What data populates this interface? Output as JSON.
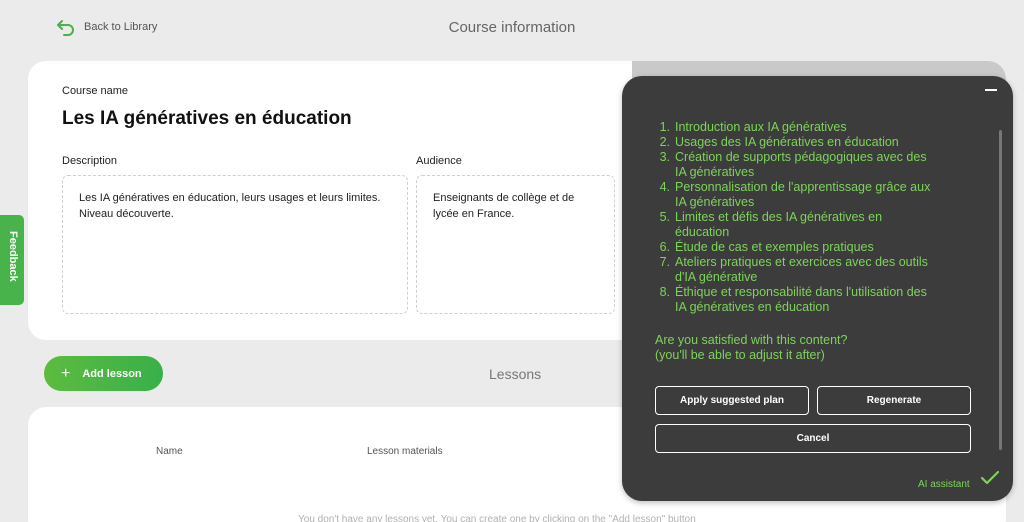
{
  "header": {
    "back_label": "Back to Library",
    "page_title": "Course information"
  },
  "course": {
    "name_label": "Course name",
    "name": "Les IA génératives en éducation",
    "description_label": "Description",
    "description": "Les IA génératives en éducation, leurs usages et leurs limites. Niveau découverte.",
    "audience_label": "Audience",
    "audience": "Enseignants de collège et de lycée en France."
  },
  "lessons": {
    "add_label": "Add lesson",
    "title": "Lessons",
    "columns": [
      "Name",
      "Lesson materials"
    ],
    "empty_message": "You don't have any lessons yet. You can create one by clicking on the \"Add lesson\" button"
  },
  "feedback_label": "Feedback",
  "ai_assistant": {
    "plan": [
      {
        "num": "1.",
        "lines": [
          "Introduction aux IA génératives"
        ]
      },
      {
        "num": "2.",
        "lines": [
          "Usages des IA génératives en éducation"
        ]
      },
      {
        "num": "3.",
        "lines": [
          "Création de supports pédagogiques avec des",
          "IA génératives"
        ]
      },
      {
        "num": "4.",
        "lines": [
          "Personnalisation de l'apprentissage grâce aux",
          "IA génératives"
        ]
      },
      {
        "num": "5.",
        "lines": [
          "Limites et défis des IA génératives en",
          "éducation"
        ]
      },
      {
        "num": "6.",
        "lines": [
          "Étude de cas et exemples pratiques"
        ]
      },
      {
        "num": "7.",
        "lines": [
          "Ateliers pratiques et exercices avec des outils",
          "d'IA générative"
        ]
      },
      {
        "num": "8.",
        "lines": [
          "Éthique et responsabilité dans l'utilisation des",
          "IA génératives en éducation"
        ]
      }
    ],
    "question_line1": "Are you satisfied with this content?",
    "question_line2": "(you'll be able to adjust it after)",
    "apply_label": "Apply suggested plan",
    "regenerate_label": "Regenerate",
    "cancel_label": "Cancel",
    "assistant_label": "AI assistant"
  },
  "colors": {
    "accent_green": "#7ed35a",
    "button_green": "#47b34a",
    "panel_bg": "#3c3c3c"
  }
}
